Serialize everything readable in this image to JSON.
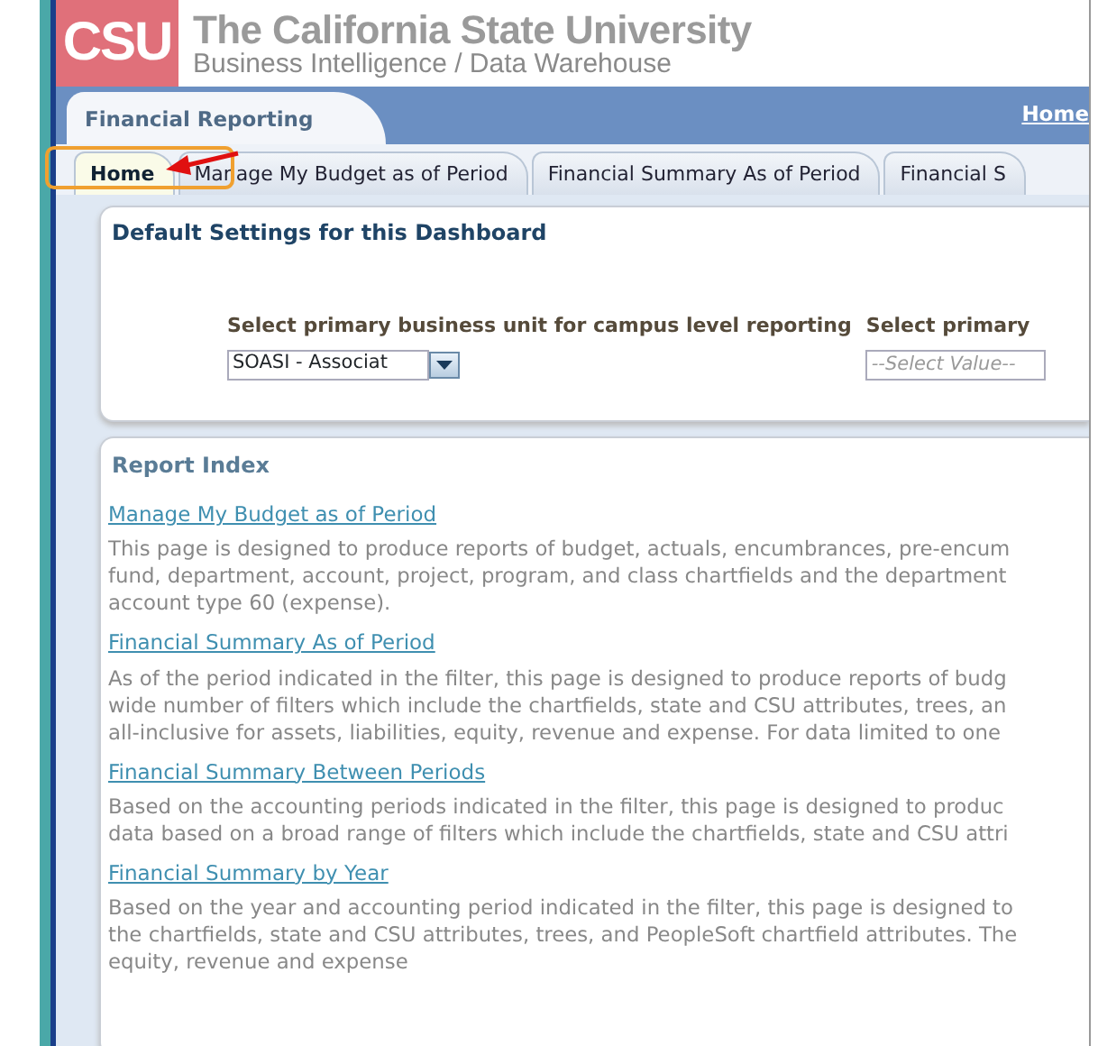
{
  "header": {
    "logo": "CSU",
    "title": "The California State University",
    "subtitle": "Business Intelligence / Data Warehouse"
  },
  "app_bar": {
    "title": "Financial Reporting",
    "link": "Home"
  },
  "tabs": [
    {
      "label": "Home",
      "selected": true
    },
    {
      "label": "Manage My Budget as of Period",
      "selected": false
    },
    {
      "label": "Financial Summary As of Period",
      "selected": false
    },
    {
      "label": "Financial S",
      "selected": false
    }
  ],
  "settings": {
    "title": "Default Settings for this Dashboard",
    "fields": [
      {
        "label": "Select primary business unit for campus level reporting",
        "value": "SOASI - Associat"
      },
      {
        "label": "Select primary",
        "placeholder": "--Select Value--"
      }
    ]
  },
  "report_index": {
    "title": "Report Index",
    "reports": [
      {
        "link": "Manage My Budget as of Period",
        "lines": [
          "This page is designed to produce reports of budget, actuals, encumbrances, pre-encum",
          "fund, department, account, project, program, and class chartfields and the department",
          "account type 60 (expense)."
        ]
      },
      {
        "link": "Financial Summary As of Period",
        "lines": [
          "As of the period indicated in the filter, this page is designed to produce reports of budg",
          "wide number of filters which include the chartfields, state and CSU attributes, trees, an",
          "all-inclusive for assets, liabilities, equity, revenue and expense. For data limited to one"
        ]
      },
      {
        "link": "Financial Summary Between Periods",
        "lines": [
          "Based on the accounting periods indicated in the filter, this page is designed to produc",
          "data based on a broad range of filters which include the chartfields, state and CSU attri"
        ]
      },
      {
        "link": "Financial Summary by Year",
        "lines": [
          "Based on the year and accounting period indicated in the filter, this page is designed to",
          "the chartfields, state and CSU attributes, trees, and PeopleSoft chartfield attributes. The",
          "equity, revenue and expense"
        ]
      }
    ]
  }
}
